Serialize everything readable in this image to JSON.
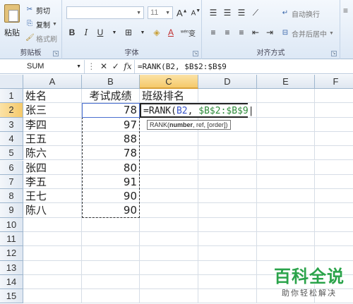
{
  "ribbon": {
    "clipboard": {
      "paste_label": "粘贴",
      "cut_label": "剪切",
      "copy_label": "复制",
      "format_painter_label": "格式刷",
      "group_label": "剪贴板"
    },
    "font": {
      "size_value": "11",
      "group_label": "字体",
      "bold": "B",
      "italic": "I",
      "underline": "U",
      "grow": "A",
      "shrink": "A",
      "wen": "wén"
    },
    "alignment": {
      "wrap_label": "自动换行",
      "merge_label": "合并后居中",
      "group_label": "对齐方式"
    }
  },
  "formula_bar": {
    "name_box": "SUM",
    "formula": "=RANK(B2, $B$2:$B$9"
  },
  "grid": {
    "columns": [
      "A",
      "B",
      "C",
      "D",
      "E",
      "F"
    ],
    "rows": [
      "1",
      "2",
      "3",
      "4",
      "5",
      "6",
      "7",
      "8",
      "9",
      "10",
      "11",
      "12",
      "13",
      "14",
      "15"
    ],
    "header_row": {
      "a": "姓名",
      "b": "考试成绩",
      "c": "班级排名"
    },
    "data": [
      {
        "name": "张三",
        "score": "78"
      },
      {
        "name": "李四",
        "score": "97"
      },
      {
        "name": "王五",
        "score": "88"
      },
      {
        "name": "陈六",
        "score": "78"
      },
      {
        "name": "张四",
        "score": "80"
      },
      {
        "name": "李五",
        "score": "91"
      },
      {
        "name": "王七",
        "score": "90"
      },
      {
        "name": "陈八",
        "score": "90"
      }
    ],
    "edit_cell": {
      "prefix": "=RANK(",
      "ref1": "B2",
      "sep": ", ",
      "ref2": "$B$2:$B$9"
    },
    "tooltip": {
      "func": "RANK(",
      "arg_bold": "number",
      "rest": ", ref, [order])"
    }
  },
  "watermark": {
    "title": "百科全说",
    "subtitle": "助你轻松解决"
  },
  "colors": {
    "ref1": "#3a56c9",
    "ref2": "#2e8b3a",
    "active_header": "#f5c96a",
    "watermark": "#2aa34a"
  }
}
